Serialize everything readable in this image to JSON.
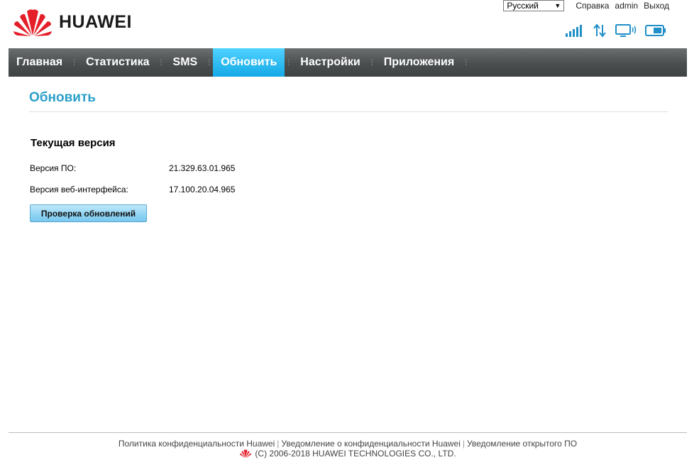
{
  "brand": {
    "name": "HUAWEI"
  },
  "top_bar": {
    "language": "Русский",
    "links": [
      "Справка",
      "admin",
      "Выход"
    ]
  },
  "status_icons": [
    "signal-strength-icon",
    "data-transfer-icon",
    "connected-device-icon",
    "battery-icon"
  ],
  "nav": {
    "items": [
      "Главная",
      "Статистика",
      "SMS",
      "Обновить",
      "Настройки",
      "Приложения"
    ],
    "active": "Обновить"
  },
  "page": {
    "title": "Обновить",
    "section_title": "Текущая версия",
    "rows": [
      {
        "label": "Версия ПО:",
        "value": "21.329.63.01.965"
      },
      {
        "label": "Версия веб-интерфейса:",
        "value": "17.100.20.04.965"
      }
    ],
    "check_button": "Проверка обновлений"
  },
  "footer": {
    "links": [
      "Политика конфиденциальности Huawei",
      "Уведомление о конфиденциальности Huawei",
      "Уведомление открытого ПО"
    ],
    "copyright": "(C) 2006-2018 HUAWEI TECHNOLOGIES CO., LTD."
  },
  "colors": {
    "accent": "#2ba0c8",
    "nav_active": "#1fb3ee",
    "nav_bg": "#4a4e4f",
    "icon_blue": "#1f8fc7",
    "brand_red": "#e41f2a"
  }
}
